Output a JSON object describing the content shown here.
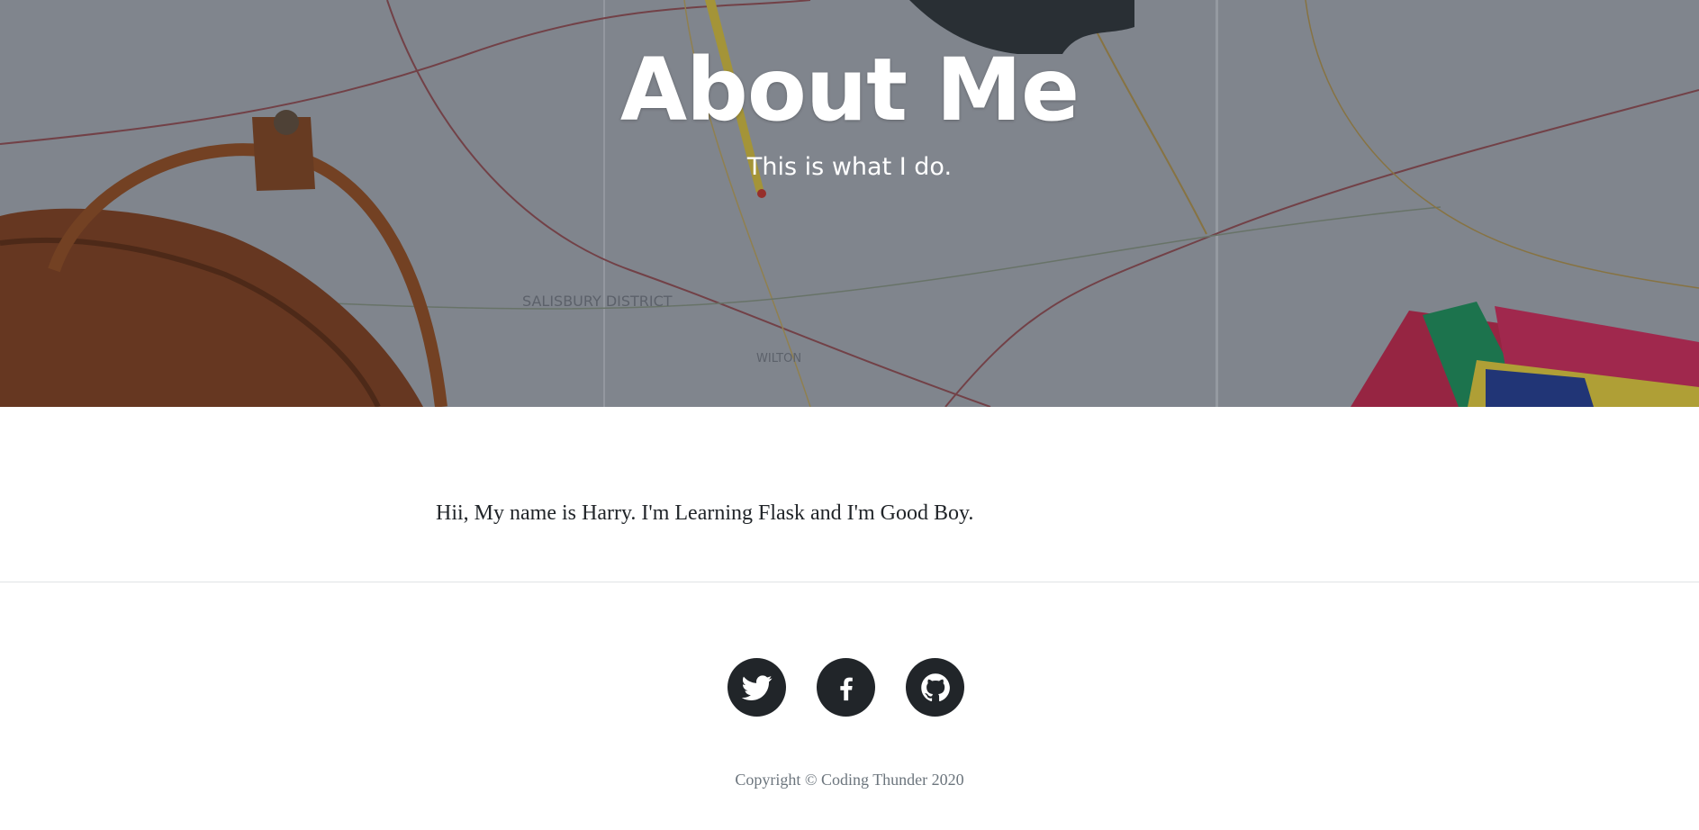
{
  "header": {
    "title": "About Me",
    "subtitle": "This is what I do."
  },
  "content": {
    "paragraph": "Hii, My name is Harry. I'm Learning Flask and I'm Good Boy."
  },
  "footer": {
    "social": [
      {
        "name": "Twitter",
        "icon": "twitter-icon"
      },
      {
        "name": "Facebook",
        "icon": "facebook-icon"
      },
      {
        "name": "GitHub",
        "icon": "github-icon"
      }
    ],
    "copyright": "Copyright © Coding Thunder 2020"
  },
  "colors": {
    "social_bg": "#212529",
    "heading_text": "#ffffff",
    "body_text": "#212529",
    "muted_text": "#6c757d"
  }
}
